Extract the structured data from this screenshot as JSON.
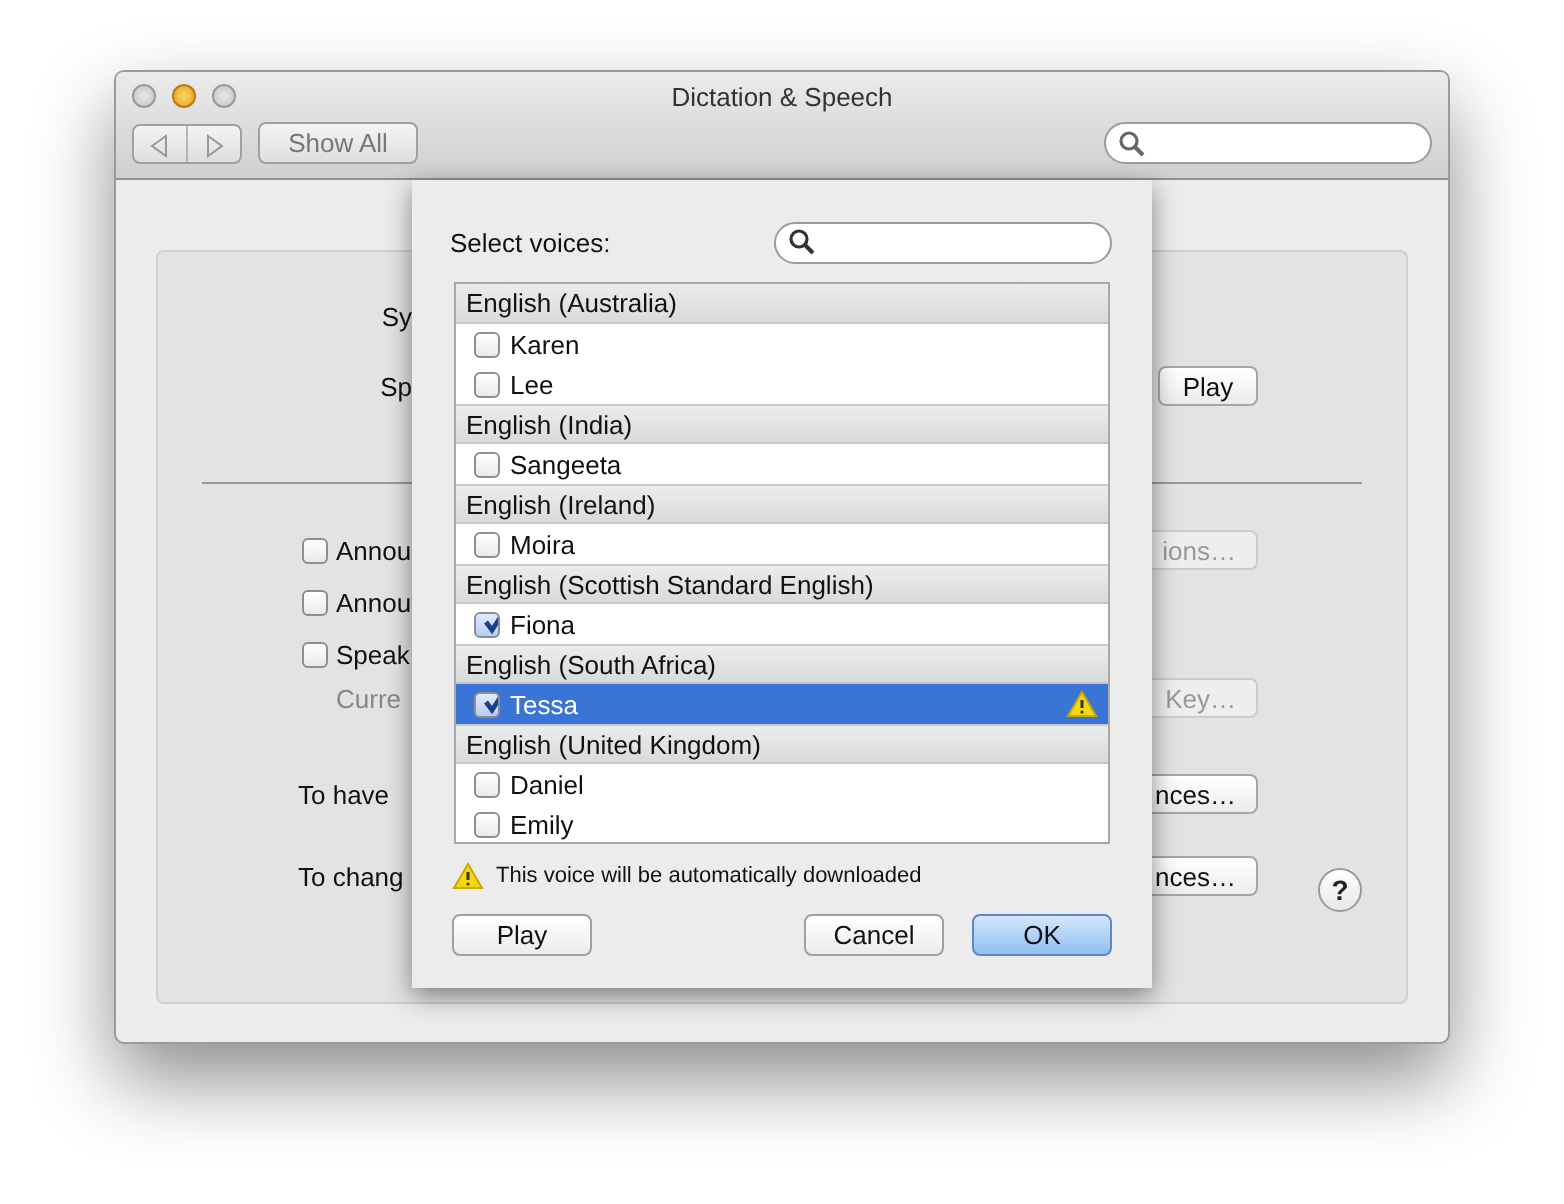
{
  "window": {
    "title": "Dictation & Speech",
    "toolbar": {
      "show_all": "Show All"
    }
  },
  "background": {
    "rows": [
      {
        "label": {
          "kind": "label",
          "text": "Sy"
        }
      },
      {
        "label": {
          "kind": "label",
          "text": "Sp"
        },
        "button": {
          "text": "Play",
          "disabled": false
        }
      },
      {
        "label": {
          "kind": "checkbox",
          "text": "Annou",
          "checked": false
        },
        "button": {
          "text": "ions…",
          "disabled": true
        }
      },
      {
        "label": {
          "kind": "checkbox",
          "text": "Annou",
          "checked": false
        }
      },
      {
        "label": {
          "kind": "checkbox",
          "text": "Speak",
          "checked": false
        }
      },
      {
        "label": {
          "kind": "dim",
          "text": "Curre"
        },
        "button": {
          "text": "Key…",
          "disabled": true
        }
      },
      {
        "label": {
          "kind": "label",
          "text": "To have"
        },
        "button": {
          "text": "nces…",
          "disabled": false
        }
      },
      {
        "label": {
          "kind": "label",
          "text": "To chang"
        },
        "button": {
          "text": "nces…",
          "disabled": false
        }
      }
    ],
    "help": "?"
  },
  "sheet": {
    "title": "Select voices:",
    "groups": [
      {
        "header": "English (Australia)",
        "voices": [
          {
            "name": "Karen",
            "checked": false,
            "selected": false,
            "needs_download": false
          },
          {
            "name": "Lee",
            "checked": false,
            "selected": false,
            "needs_download": false
          }
        ]
      },
      {
        "header": "English (India)",
        "voices": [
          {
            "name": "Sangeeta",
            "checked": false,
            "selected": false,
            "needs_download": false
          }
        ]
      },
      {
        "header": "English (Ireland)",
        "voices": [
          {
            "name": "Moira",
            "checked": false,
            "selected": false,
            "needs_download": false
          }
        ]
      },
      {
        "header": "English (Scottish Standard English)",
        "voices": [
          {
            "name": "Fiona",
            "checked": true,
            "selected": false,
            "needs_download": false
          }
        ]
      },
      {
        "header": "English (South Africa)",
        "voices": [
          {
            "name": "Tessa",
            "checked": true,
            "selected": true,
            "needs_download": true
          }
        ]
      },
      {
        "header": "English (United Kingdom)",
        "voices": [
          {
            "name": "Daniel",
            "checked": false,
            "selected": false,
            "needs_download": false
          },
          {
            "name": "Emily",
            "checked": false,
            "selected": false,
            "needs_download": false
          }
        ]
      }
    ],
    "note": "This voice will be automatically downloaded",
    "buttons": [
      {
        "text": "Play",
        "default": false
      },
      {
        "text": "Cancel",
        "default": false
      },
      {
        "text": "OK",
        "default": true
      }
    ]
  }
}
